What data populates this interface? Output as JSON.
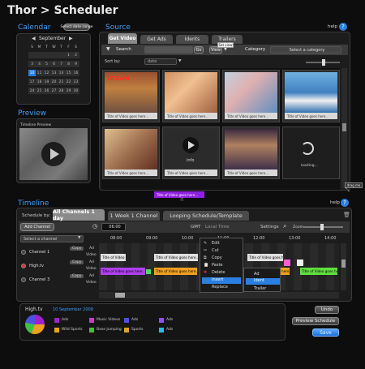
{
  "app": {
    "title": "Thor > Scheduler"
  },
  "calendar": {
    "title": "Calendar",
    "select_range_btn": "Select date range",
    "month": "September",
    "weekdays": [
      "S",
      "M",
      "T",
      "W",
      "T",
      "F",
      "S"
    ],
    "days": [
      "",
      "",
      "",
      "",
      "",
      "1",
      "2",
      "3",
      "4",
      "5",
      "6",
      "7",
      "8",
      "9",
      "10",
      "11",
      "12",
      "13",
      "14",
      "15",
      "16",
      "17",
      "18",
      "19",
      "20",
      "21",
      "22",
      "23",
      "24",
      "25",
      "26",
      "27",
      "28",
      "29",
      "30"
    ],
    "selected_day": "10"
  },
  "preview": {
    "title": "Preview",
    "caption": "Timeline Preview"
  },
  "source": {
    "title": "Source",
    "help": "help",
    "tabs": [
      "Get Video",
      "Get Ads",
      "Idents",
      "Trailers"
    ],
    "search_label": "Search",
    "go_btn": "Go",
    "view_btn": "View",
    "tooltip": "Set view",
    "category_label": "Category",
    "category_value": "Select a category",
    "sort_label": "Sort by:",
    "sort_value": "date",
    "thumb_caption": "Title of Video goes here...",
    "info_label": "info",
    "loading_label": "loading...",
    "drag_label": "drag me",
    "drag_item": "Title of Video goes here..."
  },
  "timeline": {
    "title": "Timeline",
    "help": "help",
    "schedule_by": "Schedule by:",
    "tabs": [
      "All Channels 1 day",
      "1 Week 1 Channel",
      "Looping Schedule/Template"
    ],
    "add_channel": "Add Channel",
    "time_value": "06:00",
    "gmt": "GMT",
    "local_time": "Local Time",
    "settings": "Settings",
    "zoom": "Zoom",
    "select_channel": "Select a channel",
    "hours": [
      "08:00",
      "09:00",
      "10:00",
      "11:00",
      "12:00",
      "13:00",
      "14:00"
    ],
    "channels": [
      {
        "name": "Channel 1",
        "rows": [
          "Copy",
          "Ad",
          "Video"
        ]
      },
      {
        "name": "High.tv",
        "rows": [
          "Copy",
          "Ad",
          "Video"
        ]
      },
      {
        "name": "Channel 3",
        "rows": [
          "Copy",
          "Ad",
          "Video"
        ]
      }
    ],
    "event_title": "Title of Video goes here...",
    "context_menu": [
      "Edit",
      "Cut",
      "Copy",
      "Paste",
      "Delete",
      "Insert",
      "Replace"
    ],
    "submenu": [
      "Ad",
      "Ident",
      "Trailer"
    ],
    "undo": "Undo",
    "preview_schedule": "Preview Schedule",
    "save": "Save"
  },
  "summary": {
    "channel": "High.tv",
    "date": "10 September 2008",
    "legend": [
      {
        "label": "Ads",
        "color": "#a020d0"
      },
      {
        "label": "Wild Sports",
        "color": "#f0a020"
      },
      {
        "label": "Music Videos",
        "color": "#c040c0"
      },
      {
        "label": "Base Jumping",
        "color": "#40c040"
      },
      {
        "label": "Ads",
        "color": "#5050e0"
      },
      {
        "label": "Sports",
        "color": "#e0a030"
      },
      {
        "label": "Ads",
        "color": "#9050f0"
      },
      {
        "label": "Ads",
        "color": "#20c0e0"
      }
    ]
  }
}
